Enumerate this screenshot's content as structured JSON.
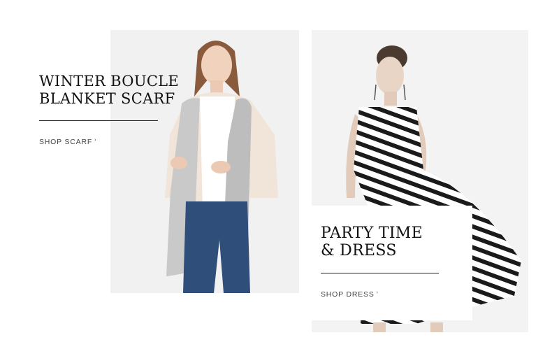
{
  "promos": [
    {
      "title_line1": "WINTER BOUCLE",
      "title_line2": "BLANKET SCARF",
      "cta_label": "SHOP SCARF",
      "cta_arrow": "›",
      "image_icon": "model-wearing-scarf-photo"
    },
    {
      "title_line1": "PARTY TIME",
      "title_line2": "& DRESS",
      "cta_label": "SHOP DRESS",
      "cta_arrow": "›",
      "image_icon": "model-in-striped-dress-photo"
    }
  ],
  "colors": {
    "panel_background": "#f1f1f1",
    "text": "#111111",
    "cta_text": "#444444",
    "scarf": "#c9c9c9",
    "jacket": "#f1e4d8",
    "jeans": "#2f4f7a",
    "stripe": "#1a1a1a"
  }
}
